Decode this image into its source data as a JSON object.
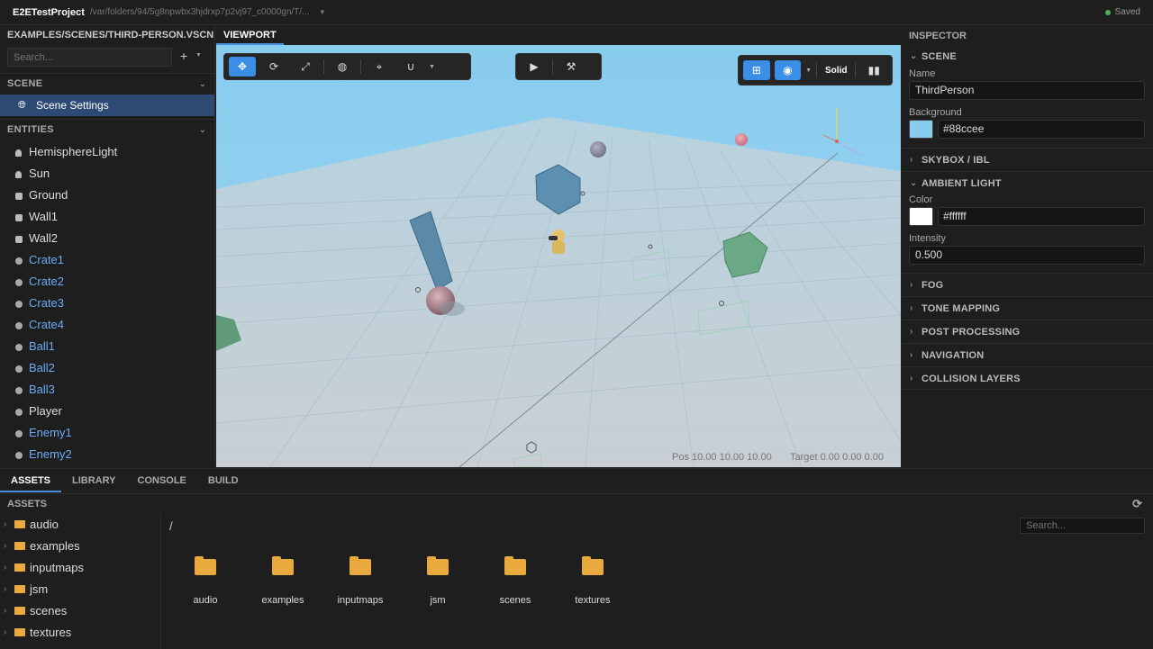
{
  "app": {
    "title": "E2ETestProject",
    "path": "/var/folders/94/5g8npwbx3hjdrxp7p2vj97_c0000gn/T/...",
    "status": "Saved"
  },
  "left": {
    "file_tab": "EXAMPLES/SCENES/THIRD-PERSON.VSCN",
    "search_placeholder": "Search...",
    "add_label": "+",
    "scene_header": "SCENE",
    "scene_item": "Scene Settings",
    "entities_header": "ENTITIES",
    "entities": [
      {
        "name": "HemisphereLight",
        "icon": "bulb-icon",
        "linked": false
      },
      {
        "name": "Sun",
        "icon": "bulb-icon",
        "linked": false
      },
      {
        "name": "Ground",
        "icon": "cube-icon",
        "linked": false
      },
      {
        "name": "Wall1",
        "icon": "cube-icon",
        "linked": false
      },
      {
        "name": "Wall2",
        "icon": "cube-icon",
        "linked": false
      },
      {
        "name": "Crate1",
        "icon": "prefab-icon",
        "linked": true
      },
      {
        "name": "Crate2",
        "icon": "prefab-icon",
        "linked": true
      },
      {
        "name": "Crate3",
        "icon": "prefab-icon",
        "linked": true
      },
      {
        "name": "Crate4",
        "icon": "prefab-icon",
        "linked": true
      },
      {
        "name": "Ball1",
        "icon": "prefab-icon",
        "linked": true
      },
      {
        "name": "Ball2",
        "icon": "prefab-icon",
        "linked": true
      },
      {
        "name": "Ball3",
        "icon": "prefab-icon",
        "linked": true
      },
      {
        "name": "Player",
        "icon": "prefab-icon",
        "linked": false
      },
      {
        "name": "Enemy1",
        "icon": "prefab-icon",
        "linked": true
      },
      {
        "name": "Enemy2",
        "icon": "prefab-icon",
        "linked": true
      }
    ]
  },
  "viewport": {
    "tab": "VIEWPORT",
    "solid_label": "Solid",
    "pos_readout": "Pos 10.00 10.00 10.00",
    "target_readout": "Target 0.00 0.00 0.00",
    "sky_color": "#88ccee"
  },
  "inspector": {
    "title": "INSPECTOR",
    "scene_section": "SCENE",
    "name_label": "Name",
    "name_value": "ThirdPerson",
    "background_label": "Background",
    "background_value": "#88ccee",
    "skybox_section": "SKYBOX / IBL",
    "ambient_section": "AMBIENT LIGHT",
    "color_label": "Color",
    "color_value": "#ffffff",
    "intensity_label": "Intensity",
    "intensity_value": "0.500",
    "sections": [
      "FOG",
      "TONE MAPPING",
      "POST PROCESSING",
      "NAVIGATION",
      "COLLISION LAYERS"
    ]
  },
  "bottom": {
    "tabs": [
      "ASSETS",
      "LIBRARY",
      "CONSOLE",
      "BUILD"
    ],
    "assets_header": "ASSETS",
    "tree": [
      "audio",
      "examples",
      "inputmaps",
      "jsm",
      "scenes",
      "textures"
    ],
    "breadcrumb": "/",
    "search_placeholder": "Search...",
    "folders": [
      "audio",
      "examples",
      "inputmaps",
      "jsm",
      "scenes",
      "textures"
    ]
  }
}
